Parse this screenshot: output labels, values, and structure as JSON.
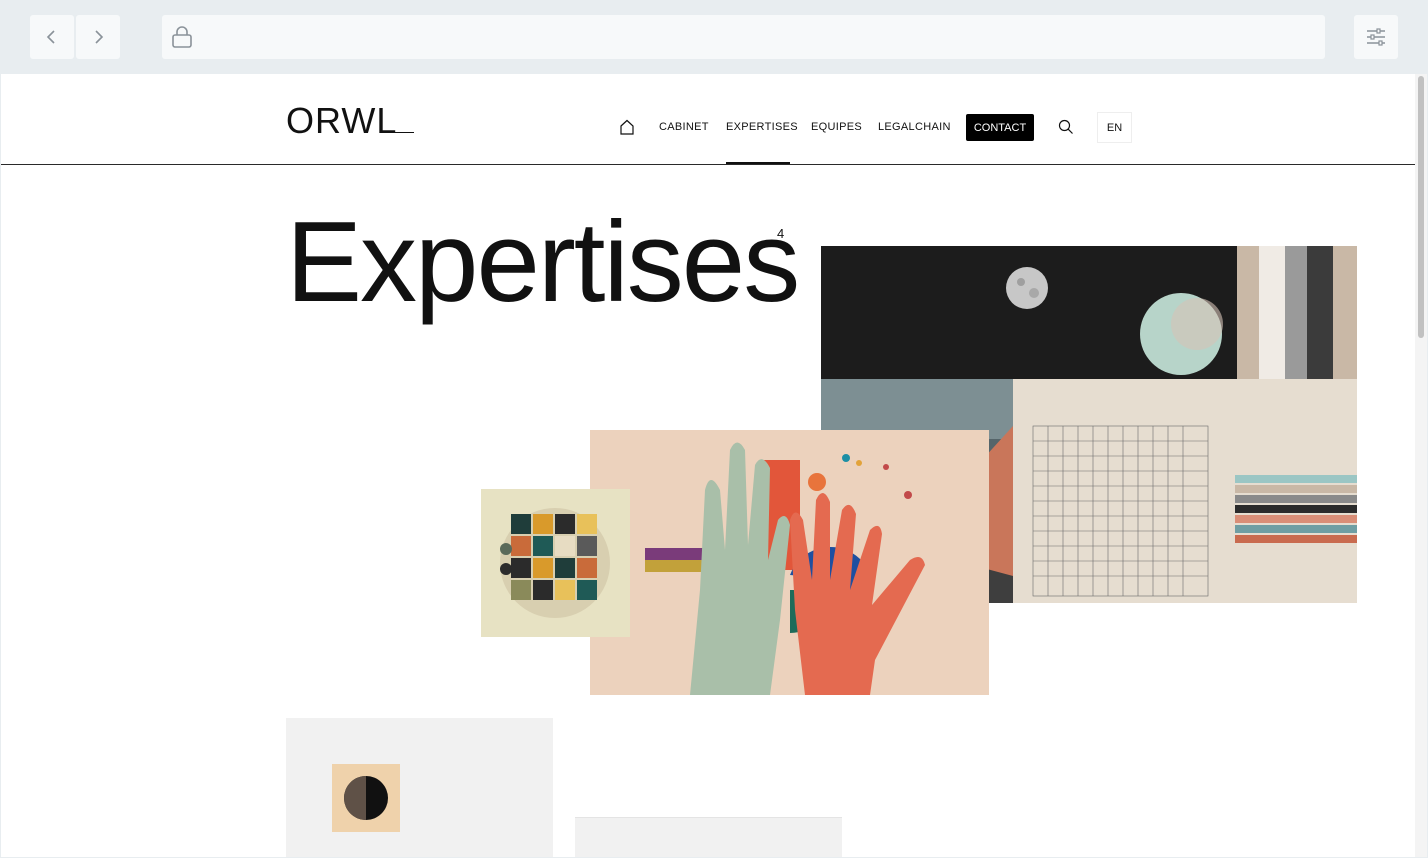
{
  "browser": {
    "back_icon": "chevron-left-icon",
    "forward_icon": "chevron-right-icon",
    "lock_icon": "lock-icon",
    "address": "",
    "settings_icon": "sliders-icon"
  },
  "site": {
    "logo": "ORWL",
    "nav": {
      "home_icon": "home-icon",
      "items": [
        "CABINET",
        "EXPERTISES",
        "EQUIPES",
        "LEGALCHAIN"
      ],
      "active": "EXPERTISES",
      "contact": "CONTACT",
      "search_icon": "search-icon",
      "lang": "EN"
    }
  },
  "hero": {
    "title": "Expertises",
    "count": "4"
  },
  "colors": {
    "accent": "#000000",
    "background": "#ffffff",
    "card_bg": "#f1f1f1"
  }
}
